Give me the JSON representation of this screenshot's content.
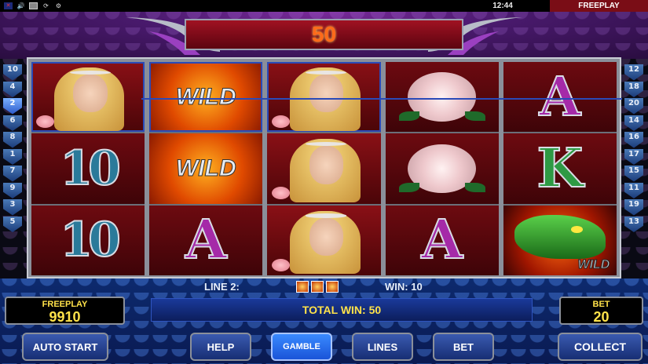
{
  "status_bar": {
    "time": "12:44",
    "mode": "FREEPLAY"
  },
  "win_banner": {
    "value": "50"
  },
  "line_indicators": {
    "left": [
      "10",
      "4",
      "2",
      "6",
      "8",
      "1",
      "7",
      "9",
      "3",
      "5"
    ],
    "right": [
      "12",
      "18",
      "20",
      "14",
      "16",
      "17",
      "15",
      "11",
      "19",
      "13"
    ],
    "active": "2"
  },
  "reels": [
    [
      {
        "symbol": "princess"
      },
      {
        "symbol": "10",
        "text": "10"
      },
      {
        "symbol": "10",
        "text": "10"
      }
    ],
    [
      {
        "symbol": "wild",
        "text": "WILD"
      },
      {
        "symbol": "wild",
        "text": "WILD"
      },
      {
        "symbol": "A",
        "text": "A"
      }
    ],
    [
      {
        "symbol": "princess"
      },
      {
        "symbol": "princess"
      },
      {
        "symbol": "princess"
      }
    ],
    [
      {
        "symbol": "rose"
      },
      {
        "symbol": "rose"
      },
      {
        "symbol": "A",
        "text": "A"
      }
    ],
    [
      {
        "symbol": "A",
        "text": "A"
      },
      {
        "symbol": "K",
        "text": "K"
      },
      {
        "symbol": "dragon-wild",
        "text": "WILD"
      }
    ]
  ],
  "win_line": {
    "label": "LINE 2:",
    "win_label": "WIN: 10",
    "symbol_icons": [
      "princess",
      "princess",
      "princess"
    ]
  },
  "credit": {
    "label": "FREEPLAY",
    "value": "9910"
  },
  "total_win": "TOTAL WIN: 50",
  "bet": {
    "label": "BET",
    "value": "20"
  },
  "buttons": {
    "autostart": "AUTO START",
    "help": "HELP",
    "gamble": "GAMBLE",
    "lines": "LINES",
    "bet": "BET",
    "collect": "COLLECT"
  },
  "colors": {
    "accent": "#ffe24a",
    "win": "#ff6a1a",
    "panel": "#0d2a6e",
    "payline": "#2a4ab8"
  }
}
